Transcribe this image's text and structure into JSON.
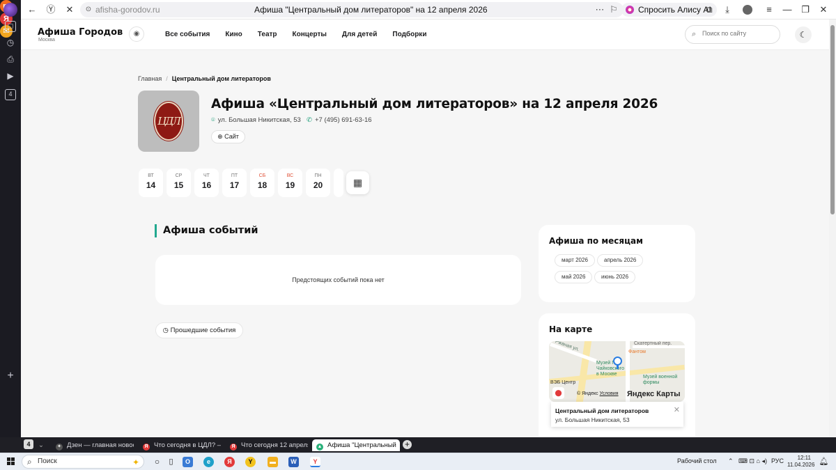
{
  "browser": {
    "url": "afisha-gorodov.ru",
    "page_title": "Афиша \"Центральный дом литераторов\" на 12 апреля 2026",
    "alice_label": "Спросить Алису AI",
    "tab_count": "4",
    "tabs": [
      {
        "label": "Дзен — главная новостн",
        "active": false
      },
      {
        "label": "Что сегодня в ЦДЛ? — Я",
        "active": false
      },
      {
        "label": "Что сегодня 12 апреля в",
        "active": false
      },
      {
        "label": "Афиша \"Центральный",
        "active": true
      }
    ]
  },
  "site": {
    "brand": "Афиша Городов",
    "city": "Москва",
    "nav": [
      "Все события",
      "Кино",
      "Театр",
      "Концерты",
      "Для детей",
      "Подборки"
    ],
    "search_placeholder": "Поиск по сайту"
  },
  "page": {
    "breadcrumb": {
      "home": "Главная",
      "current": "Центральный дом литераторов"
    },
    "logo_text": "ЦДЛ",
    "title": "Афиша «Центральный дом литераторов» на 12 апреля 2026",
    "address": "ул. Большая Никитская, 53",
    "phone": "+7 (495) 691-63-16",
    "site_button": "Сайт",
    "dates": [
      {
        "dow": "ВТ",
        "day": "14",
        "weekend": false
      },
      {
        "dow": "СР",
        "day": "15",
        "weekend": false
      },
      {
        "dow": "ЧТ",
        "day": "16",
        "weekend": false
      },
      {
        "dow": "ПТ",
        "day": "17",
        "weekend": false
      },
      {
        "dow": "СБ",
        "day": "18",
        "weekend": true
      },
      {
        "dow": "ВС",
        "day": "19",
        "weekend": true
      },
      {
        "dow": "ПН",
        "day": "20",
        "weekend": false
      }
    ],
    "events_title": "Афиша событий",
    "no_events": "Предстоящих событий пока нет",
    "past_events": "Прошедшие события"
  },
  "sidebar": {
    "months_title": "Афиша по месяцам",
    "months": [
      "март 2026",
      "апрель 2026",
      "май 2026",
      "июнь 2026"
    ],
    "map_title": "На карте",
    "map": {
      "labels": {
        "street": "Скатертный пер.",
        "cross": "Ржаная ул.",
        "museum1": "Музей П.И. Чайковского в Москве",
        "phantom": "Фантом",
        "museum2": "Музей военной формы",
        "veb": "ВЭБ Центр"
      },
      "copyright": "© Яндекс",
      "terms": "Условия",
      "brand": "Яндекс Карты",
      "balloon_name": "Центральный дом литераторов",
      "balloon_address": "ул. Большая Никитская, 53"
    }
  },
  "taskbar": {
    "search": "Поиск",
    "desktop": "Рабочий стол",
    "lang": "РУС",
    "time": "12:11",
    "date": "11.04.2026"
  }
}
